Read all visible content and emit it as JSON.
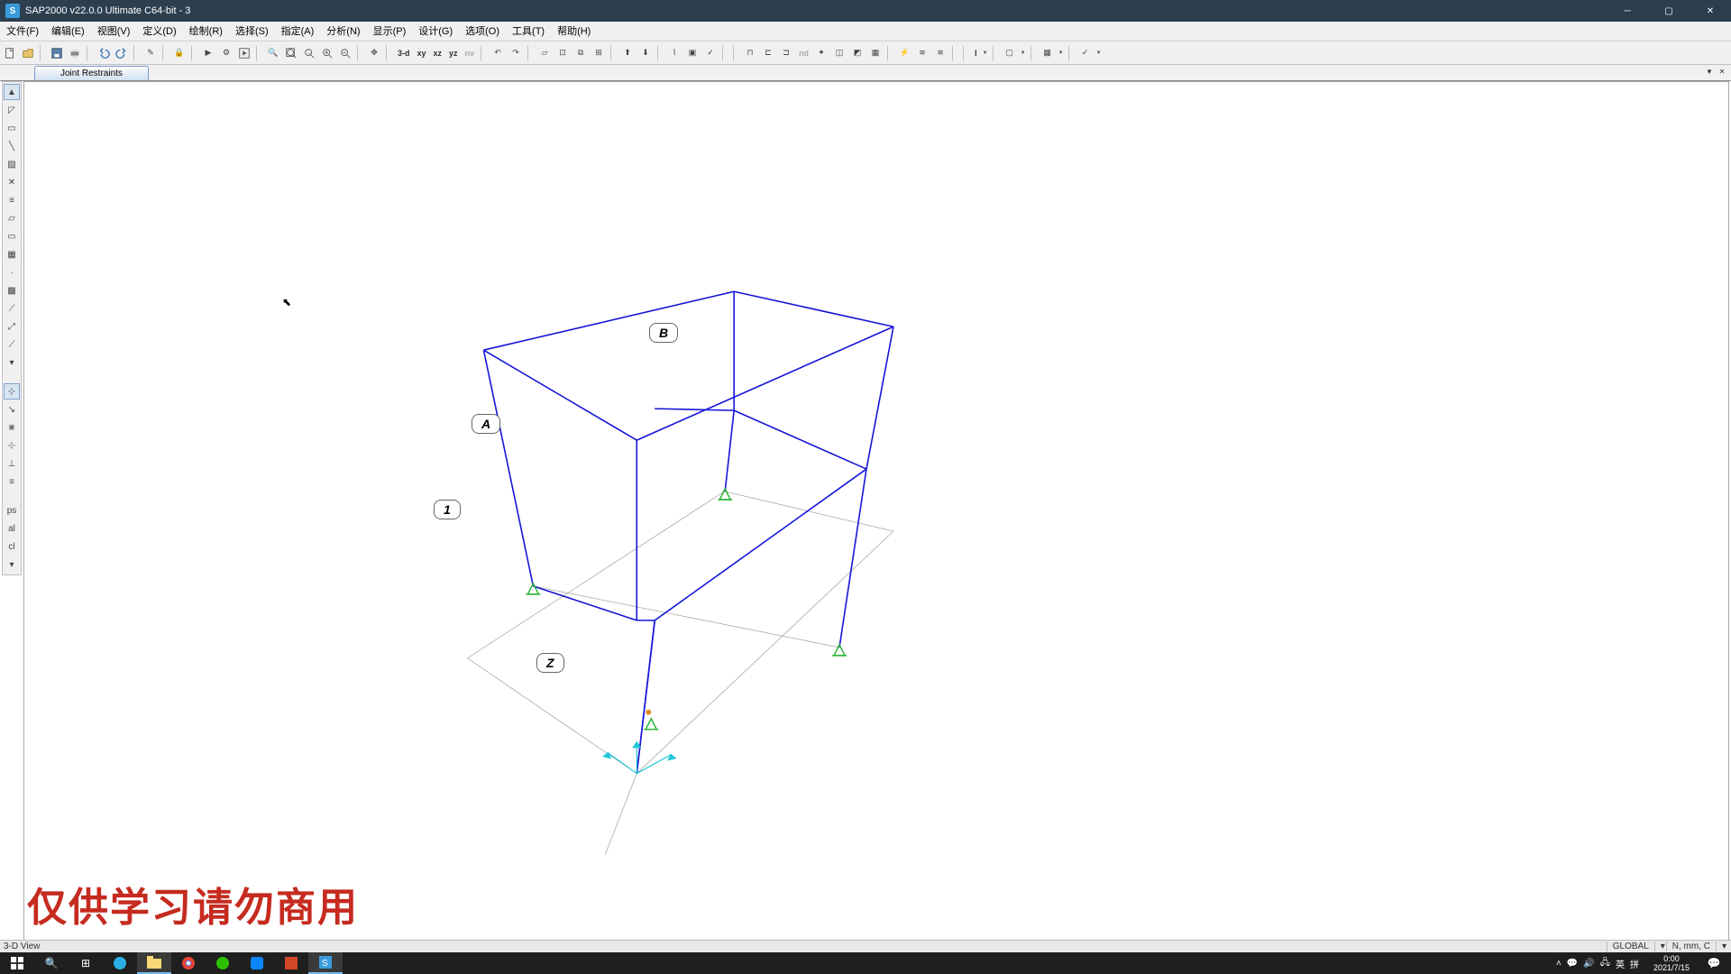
{
  "titlebar": {
    "app_letter": "S",
    "title": "SAP2000 v22.0.0 Ultimate C64-bit - 3"
  },
  "menus": [
    "文件(F)",
    "编辑(E)",
    "视图(V)",
    "定义(D)",
    "绘制(R)",
    "选择(S)",
    "指定(A)",
    "分析(N)",
    "显示(P)",
    "设计(G)",
    "选项(O)",
    "工具(T)",
    "帮助(H)"
  ],
  "toolbar_labels": {
    "t3d": "3-d",
    "txy": "xy",
    "txz": "xz",
    "tyz": "yz",
    "tnv": "nv",
    "tnd": "nd",
    "tI": "I",
    "tbox": "□",
    "tfill": "▦",
    "tarrow": "✓"
  },
  "viewtab": {
    "label": "Joint Restraints"
  },
  "status": {
    "left": "3-D View",
    "coord": "GLOBAL",
    "units": "N, mm, C"
  },
  "watermark": "仅供学习请勿商用",
  "grid_labels": {
    "A": "A",
    "one": "1",
    "Z": "Z",
    "B": "B"
  },
  "clock": {
    "time": "0:00",
    "date": "2021/7/15"
  },
  "tray": {
    "lang1": "英",
    "lang2": "拼"
  }
}
